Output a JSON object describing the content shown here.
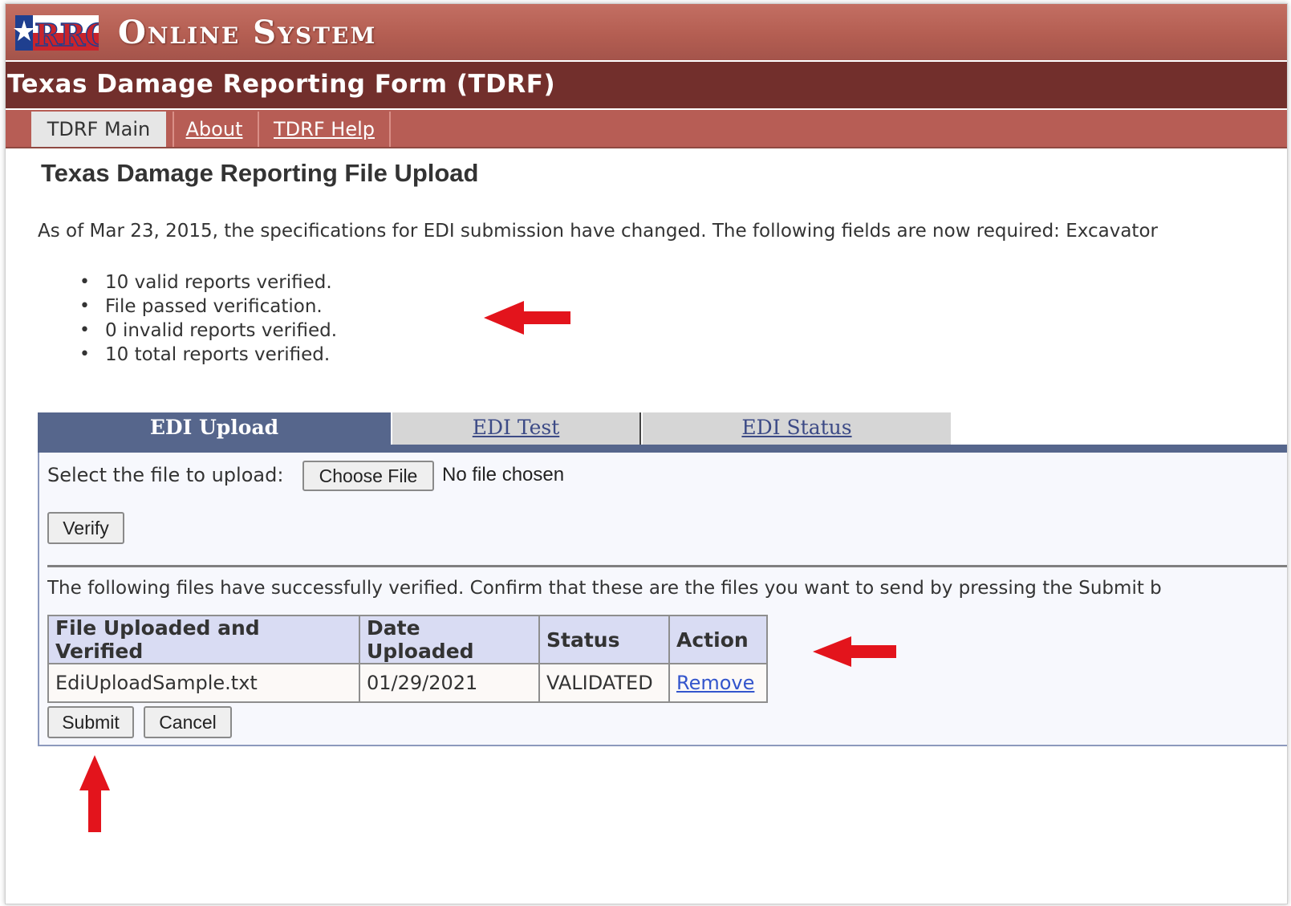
{
  "header": {
    "logo_text": "RRC",
    "system_title": "Online System",
    "form_title": "Texas Damage Reporting Form (TDRF)"
  },
  "nav": {
    "items": [
      {
        "label": "TDRF Main",
        "active": true
      },
      {
        "label": "About",
        "active": false
      },
      {
        "label": "TDRF Help",
        "active": false
      }
    ]
  },
  "page": {
    "title": "Texas Damage Reporting File Upload",
    "notice": "As of Mar 23, 2015, the specifications for EDI submission have changed. The following fields are now required: Excavator",
    "results": [
      "10 valid reports verified.",
      "File passed verification.",
      "0 invalid reports verified.",
      "10 total reports verified."
    ]
  },
  "tabs": [
    {
      "label": "EDI Upload",
      "active": true
    },
    {
      "label": "EDI Test",
      "active": false
    },
    {
      "label": "EDI Status",
      "active": false
    }
  ],
  "upload": {
    "select_label": "Select the file to upload:",
    "choose_button": "Choose File",
    "no_file_text": "No file chosen",
    "verify_button": "Verify",
    "confirm_text": "The following files have successfully verified. Confirm that these are the files you want to send by pressing the Submit b"
  },
  "files_table": {
    "headers": [
      "File Uploaded and Verified",
      "Date Uploaded",
      "Status",
      "Action"
    ],
    "rows": [
      {
        "file": "EdiUploadSample.txt",
        "date": "01/29/2021",
        "status": "VALIDATED",
        "action": "Remove"
      }
    ]
  },
  "actions": {
    "submit_button": "Submit",
    "cancel_button": "Cancel"
  },
  "colors": {
    "header_red": "#b45e52",
    "form_bar": "#722f2c",
    "tab_active": "#56668c",
    "annotation_arrow": "#e3141c"
  },
  "icons": {
    "logo": "texas-flag-star-icon",
    "annotation": "red-arrow-icon"
  }
}
